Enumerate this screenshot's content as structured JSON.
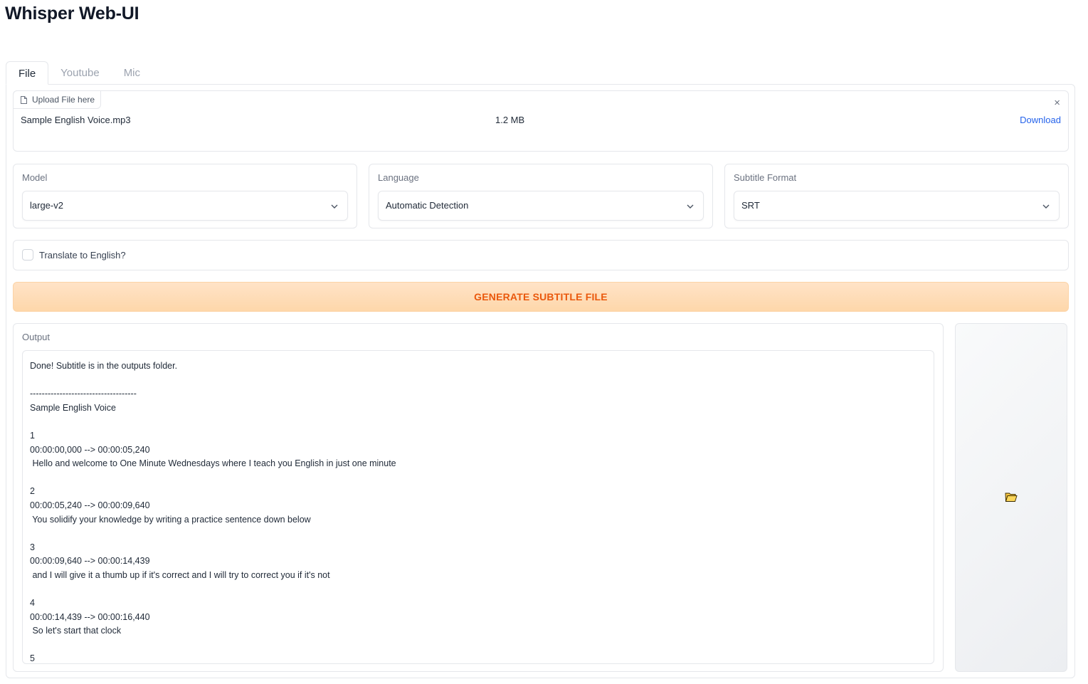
{
  "app": {
    "title": "Whisper Web-UI"
  },
  "tabs": [
    {
      "label": "File",
      "active": true
    },
    {
      "label": "Youtube",
      "active": false
    },
    {
      "label": "Mic",
      "active": false
    }
  ],
  "file_upload": {
    "label": "Upload File here",
    "file_name": "Sample English Voice.mp3",
    "file_size": "1.2 MB",
    "download_label": "Download",
    "close_glyph": "×"
  },
  "dropdowns": {
    "model": {
      "label": "Model",
      "value": "large-v2"
    },
    "language": {
      "label": "Language",
      "value": "Automatic Detection"
    },
    "subtitle_format": {
      "label": "Subtitle Format",
      "value": "SRT"
    }
  },
  "translate": {
    "label": "Translate to English?",
    "checked": false
  },
  "generate_button": {
    "label": "GENERATE SUBTITLE FILE"
  },
  "output": {
    "label": "Output",
    "lines": [
      "Done! Subtitle is in the outputs folder.",
      "",
      "------------------------------------",
      "Sample English Voice",
      "",
      "1",
      "00:00:00,000 --> 00:00:05,240",
      " Hello and welcome to One Minute Wednesdays where I teach you English in just one minute",
      "",
      "2",
      "00:00:05,240 --> 00:00:09,640",
      " You solidify your knowledge by writing a practice sentence down below",
      "",
      "3",
      "00:00:09,640 --> 00:00:14,439",
      " and I will give it a thumb up if it's correct and I will try to correct you if it's not",
      "",
      "4",
      "00:00:14,439 --> 00:00:16,440",
      " So let's start that clock",
      "",
      "5"
    ]
  },
  "colors": {
    "accent_orange": "#ea580c",
    "button_bg": "#fed7aa",
    "link_blue": "#2563eb"
  },
  "icons": [
    "file-icon",
    "close-icon",
    "chevron-down-icon",
    "folder-icon"
  ]
}
